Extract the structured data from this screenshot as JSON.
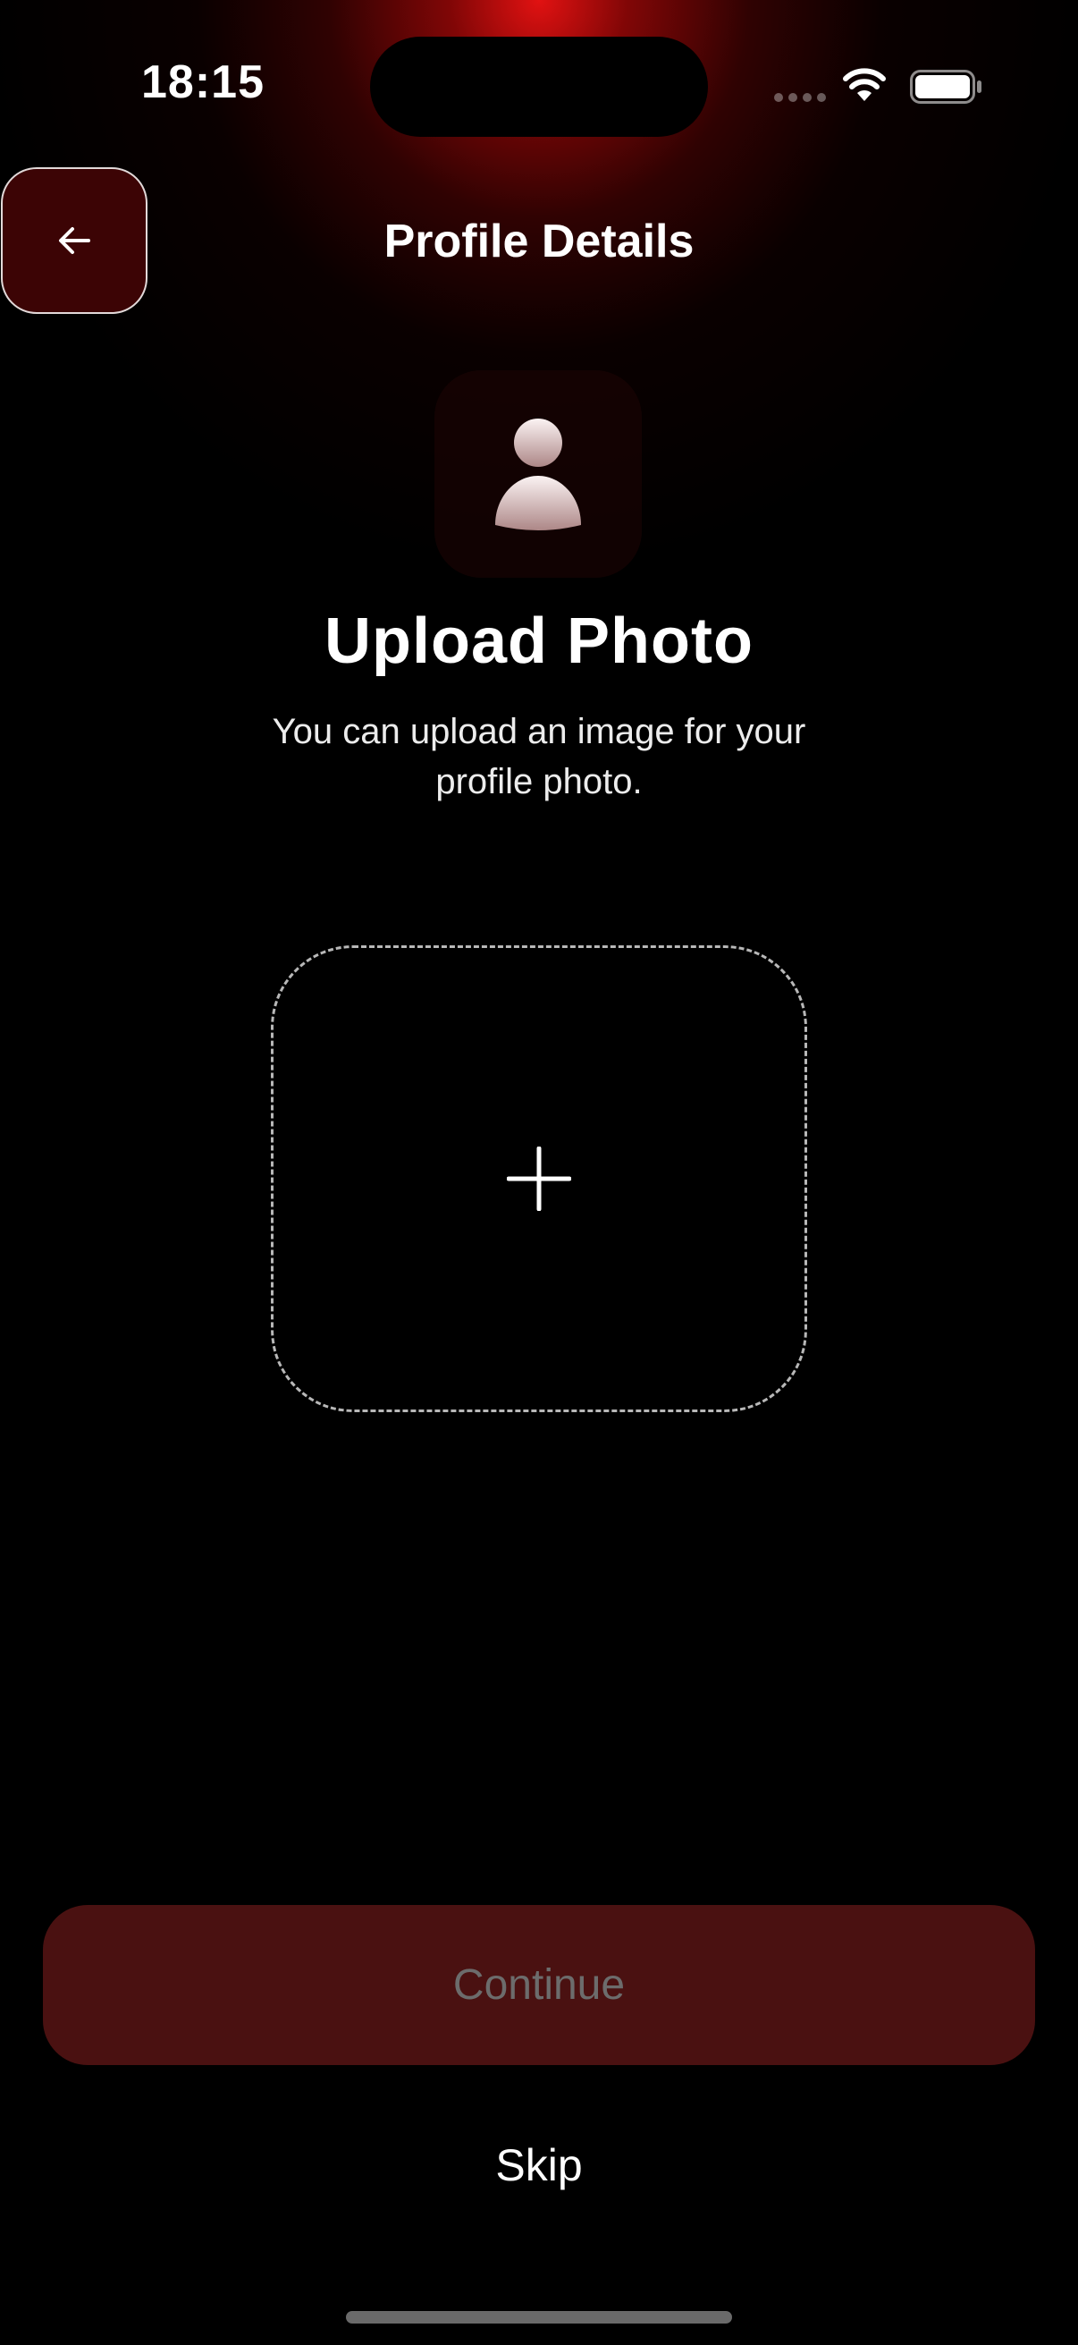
{
  "status_bar": {
    "time": "18:15"
  },
  "header": {
    "back_icon": "arrow-left-icon",
    "title": "Profile Details"
  },
  "avatar": {
    "icon": "person-icon"
  },
  "upload": {
    "heading": "Upload Photo",
    "subtitle": "You can upload an image for your profile photo.",
    "add_icon": "plus-icon"
  },
  "actions": {
    "continue_label": "Continue",
    "skip_label": "Skip"
  },
  "colors": {
    "accent_glow": "#e61212",
    "continue_bg": "#4a1111",
    "continue_text": "#6c6c6c",
    "background": "#000000"
  }
}
